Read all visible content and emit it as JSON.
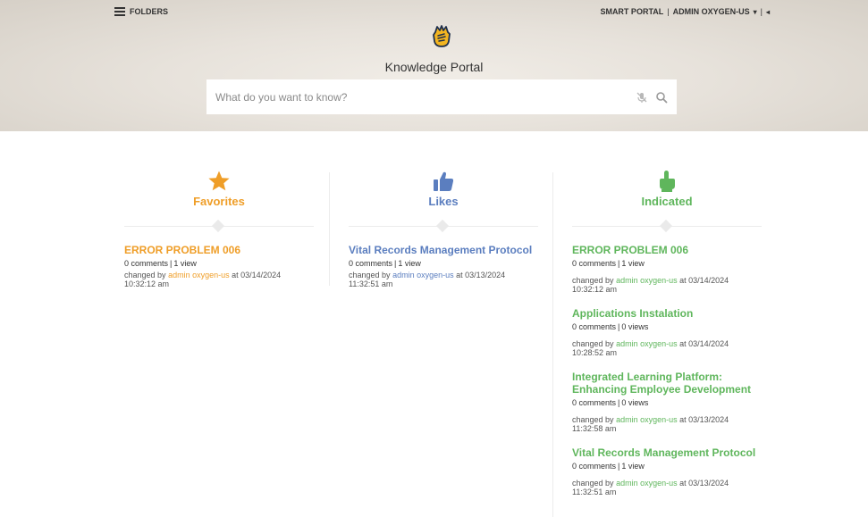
{
  "topbar": {
    "folders_label": "FOLDERS",
    "smart_portal": "SMART PORTAL",
    "separator": "|",
    "user": "ADMIN OXYGEN-US",
    "caret": "▾",
    "collapse": "◂"
  },
  "header": {
    "title": "Knowledge Portal"
  },
  "search": {
    "placeholder": "What do you want to know?"
  },
  "colors": {
    "favorites": "#ef9e28",
    "likes": "#5b7ebf",
    "indicated": "#5fb65c"
  },
  "columns": {
    "favorites": {
      "title": "Favorites",
      "icon": "star-icon",
      "items": [
        {
          "title": "ERROR PROBLEM 006",
          "comments": "0 comments",
          "views": "1 view",
          "changed_by": "changed by",
          "user": "admin oxygen-us",
          "at": "at 03/14/2024",
          "time": "10:32:12 am"
        }
      ]
    },
    "likes": {
      "title": "Likes",
      "icon": "thumbs-up-icon",
      "items": [
        {
          "title": "Vital Records Management Protocol",
          "comments": "0 comments",
          "views": "1 view",
          "changed_by": "changed by",
          "user": "admin oxygen-us",
          "at": "at 03/13/2024",
          "time": "11:32:51 am"
        }
      ]
    },
    "indicated": {
      "title": "Indicated",
      "icon": "pointing-hand-icon",
      "items": [
        {
          "title": "ERROR PROBLEM 006",
          "comments": "0 comments",
          "views": "1 view",
          "changed_by": "changed by",
          "user": "admin oxygen-us",
          "at": "at 03/14/2024",
          "time": "10:32:12 am"
        },
        {
          "title": "Applications Instalation",
          "comments": "0 comments",
          "views": "0 views",
          "changed_by": "changed by",
          "user": "admin oxygen-us",
          "at": "at 03/14/2024",
          "time": "10:28:52 am"
        },
        {
          "title": "Integrated Learning Platform: Enhancing Employee Development",
          "comments": "0 comments",
          "views": "0 views",
          "changed_by": "changed by",
          "user": "admin oxygen-us",
          "at": "at 03/13/2024",
          "time": "11:32:58 am"
        },
        {
          "title": "Vital Records Management Protocol",
          "comments": "0 comments",
          "views": "1 view",
          "changed_by": "changed by",
          "user": "admin oxygen-us",
          "at": "at 03/13/2024",
          "time": "11:32:51 am"
        }
      ]
    }
  }
}
